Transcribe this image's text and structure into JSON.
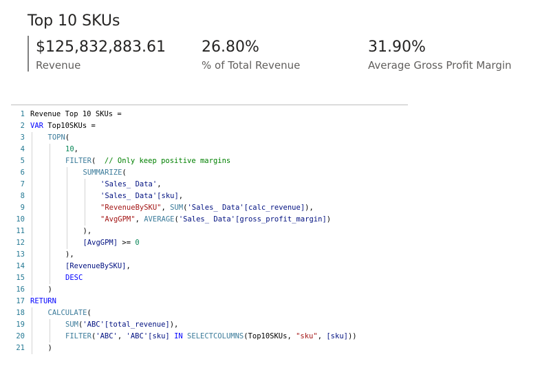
{
  "card": {
    "title": "Top 10 SKUs",
    "kpis": [
      {
        "value": "$125,832,883.61",
        "label": "Revenue"
      },
      {
        "value": "26.80%",
        "label": "% of Total Revenue"
      },
      {
        "value": "31.90%",
        "label": "Average Gross Profit Margin"
      }
    ]
  },
  "code": {
    "lines": [
      {
        "n": "1",
        "indent": 0,
        "tokens": [
          [
            "def",
            "Revenue Top 10 SKUs ="
          ]
        ]
      },
      {
        "n": "2",
        "indent": 0,
        "tokens": [
          [
            "kw",
            "VAR "
          ],
          [
            "def",
            "Top10SKUs ="
          ]
        ]
      },
      {
        "n": "3",
        "indent": 1,
        "tokens": [
          [
            "fn",
            "TOPN"
          ],
          [
            "def",
            "("
          ]
        ]
      },
      {
        "n": "4",
        "indent": 2,
        "tokens": [
          [
            "num",
            "10"
          ],
          [
            "def",
            ","
          ]
        ]
      },
      {
        "n": "5",
        "indent": 2,
        "tokens": [
          [
            "fn",
            "FILTER"
          ],
          [
            "def",
            "(  "
          ],
          [
            "cmt",
            "// Only keep positive margins"
          ]
        ]
      },
      {
        "n": "6",
        "indent": 3,
        "tokens": [
          [
            "fn",
            "SUMMARIZE"
          ],
          [
            "def",
            "("
          ]
        ]
      },
      {
        "n": "7",
        "indent": 4,
        "tokens": [
          [
            "tbl",
            "'Sales_ Data'"
          ],
          [
            "def",
            ","
          ]
        ]
      },
      {
        "n": "8",
        "indent": 4,
        "tokens": [
          [
            "tbl",
            "'Sales_ Data'[sku]"
          ],
          [
            "def",
            ","
          ]
        ]
      },
      {
        "n": "9",
        "indent": 4,
        "tokens": [
          [
            "str",
            "\"RevenueBySKU\""
          ],
          [
            "def",
            ", "
          ],
          [
            "fn",
            "SUM"
          ],
          [
            "def",
            "("
          ],
          [
            "tbl",
            "'Sales_ Data'[calc_revenue]"
          ],
          [
            "def",
            "),"
          ]
        ]
      },
      {
        "n": "10",
        "indent": 4,
        "tokens": [
          [
            "str",
            "\"AvgGPM\""
          ],
          [
            "def",
            ", "
          ],
          [
            "fn",
            "AVERAGE"
          ],
          [
            "def",
            "("
          ],
          [
            "tbl",
            "'Sales_ Data'[gross_profit_margin]"
          ],
          [
            "def",
            ")"
          ]
        ]
      },
      {
        "n": "11",
        "indent": 3,
        "tokens": [
          [
            "def",
            "),"
          ]
        ]
      },
      {
        "n": "12",
        "indent": 3,
        "tokens": [
          [
            "tbl",
            "[AvgGPM]"
          ],
          [
            "def",
            " >= "
          ],
          [
            "num",
            "0"
          ]
        ]
      },
      {
        "n": "13",
        "indent": 2,
        "tokens": [
          [
            "def",
            "),"
          ]
        ]
      },
      {
        "n": "14",
        "indent": 2,
        "tokens": [
          [
            "tbl",
            "[RevenueBySKU]"
          ],
          [
            "def",
            ","
          ]
        ]
      },
      {
        "n": "15",
        "indent": 2,
        "tokens": [
          [
            "kw",
            "DESC"
          ]
        ]
      },
      {
        "n": "16",
        "indent": 1,
        "tokens": [
          [
            "def",
            ")"
          ]
        ]
      },
      {
        "n": "17",
        "indent": 0,
        "tokens": [
          [
            "kw",
            "RETURN"
          ]
        ]
      },
      {
        "n": "18",
        "indent": 1,
        "tokens": [
          [
            "fn",
            "CALCULATE"
          ],
          [
            "def",
            "("
          ]
        ]
      },
      {
        "n": "19",
        "indent": 2,
        "tokens": [
          [
            "fn",
            "SUM"
          ],
          [
            "def",
            "("
          ],
          [
            "tbl",
            "'ABC'[total_revenue]"
          ],
          [
            "def",
            "),"
          ]
        ]
      },
      {
        "n": "20",
        "indent": 2,
        "tokens": [
          [
            "fn",
            "FILTER"
          ],
          [
            "def",
            "("
          ],
          [
            "tbl",
            "'ABC'"
          ],
          [
            "def",
            ", "
          ],
          [
            "tbl",
            "'ABC'[sku]"
          ],
          [
            "def",
            " "
          ],
          [
            "kw",
            "IN "
          ],
          [
            "fn",
            "SELECTCOLUMNS"
          ],
          [
            "def",
            "(Top10SKUs, "
          ],
          [
            "str",
            "\"sku\""
          ],
          [
            "def",
            ", "
          ],
          [
            "tbl",
            "[sku]"
          ],
          [
            "def",
            "))"
          ]
        ]
      },
      {
        "n": "21",
        "indent": 1,
        "tokens": [
          [
            "def",
            ")"
          ]
        ]
      }
    ]
  }
}
